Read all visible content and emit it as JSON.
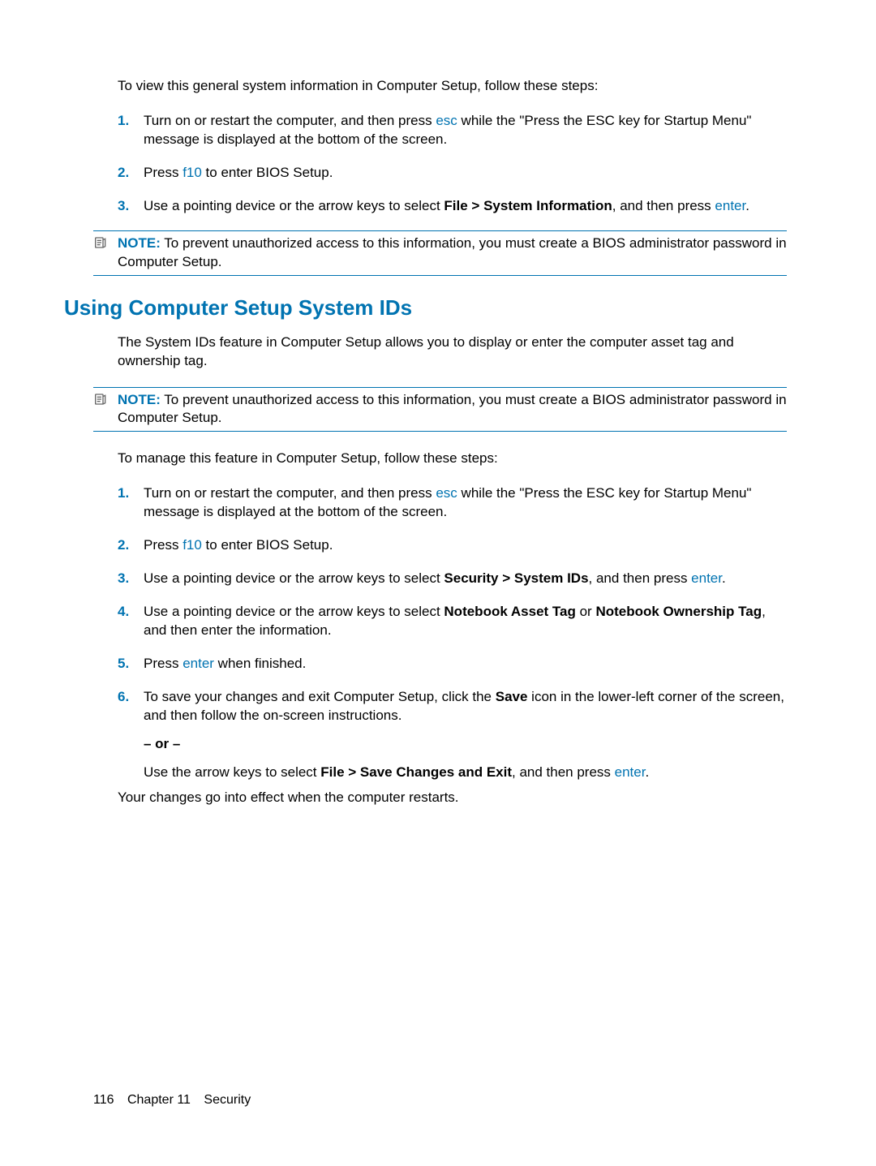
{
  "section1": {
    "intro": "To view this general system information in Computer Setup, follow these steps:",
    "steps": {
      "n1": "1.",
      "s1a": "Turn on or restart the computer, and then press ",
      "s1key": "esc",
      "s1b": " while the \"Press the ESC key for Startup Menu\" message is displayed at the bottom of the screen.",
      "n2": "2.",
      "s2a": "Press ",
      "s2key": "f10",
      "s2b": " to enter BIOS Setup.",
      "n3": "3.",
      "s3a": "Use a pointing device or the arrow keys to select ",
      "s3bold": "File > System Information",
      "s3b": ", and then press ",
      "s3key": "enter",
      "s3c": "."
    },
    "note": {
      "label": "NOTE:",
      "text": "   To prevent unauthorized access to this information, you must create a BIOS administrator password in Computer Setup."
    }
  },
  "section2": {
    "heading": "Using Computer Setup System IDs",
    "intro": "The System IDs feature in Computer Setup allows you to display or enter the computer asset tag and ownership tag.",
    "note": {
      "label": "NOTE:",
      "text": "   To prevent unauthorized access to this information, you must create a BIOS administrator password in Computer Setup."
    },
    "intro2": "To manage this feature in Computer Setup, follow these steps:",
    "steps": {
      "n1": "1.",
      "s1a": "Turn on or restart the computer, and then press ",
      "s1key": "esc",
      "s1b": " while the \"Press the ESC key for Startup Menu\" message is displayed at the bottom of the screen.",
      "n2": "2.",
      "s2a": "Press ",
      "s2key": "f10",
      "s2b": " to enter BIOS Setup.",
      "n3": "3.",
      "s3a": "Use a pointing device or the arrow keys to select ",
      "s3bold": "Security > System IDs",
      "s3b": ", and then press ",
      "s3key": "enter",
      "s3c": ".",
      "n4": "4.",
      "s4a": "Use a pointing device or the arrow keys to select ",
      "s4bold1": "Notebook Asset Tag",
      "s4b": " or ",
      "s4bold2": "Notebook Ownership Tag",
      "s4c": ", and then enter the information.",
      "n5": "5.",
      "s5a": "Press ",
      "s5key": "enter",
      "s5b": " when finished.",
      "n6": "6.",
      "s6a": "To save your changes and exit Computer Setup, click the ",
      "s6bold": "Save",
      "s6b": " icon in the lower-left corner of the screen, and then follow the on-screen instructions.",
      "s6or": "– or –",
      "s6c": "Use the arrow keys to select ",
      "s6bold2": "File > Save Changes and Exit",
      "s6d": ", and then press ",
      "s6key": "enter",
      "s6e": "."
    },
    "outro": "Your changes go into effect when the computer restarts."
  },
  "footer": {
    "page": "116",
    "chapter": "Chapter 11",
    "title": "Security"
  }
}
